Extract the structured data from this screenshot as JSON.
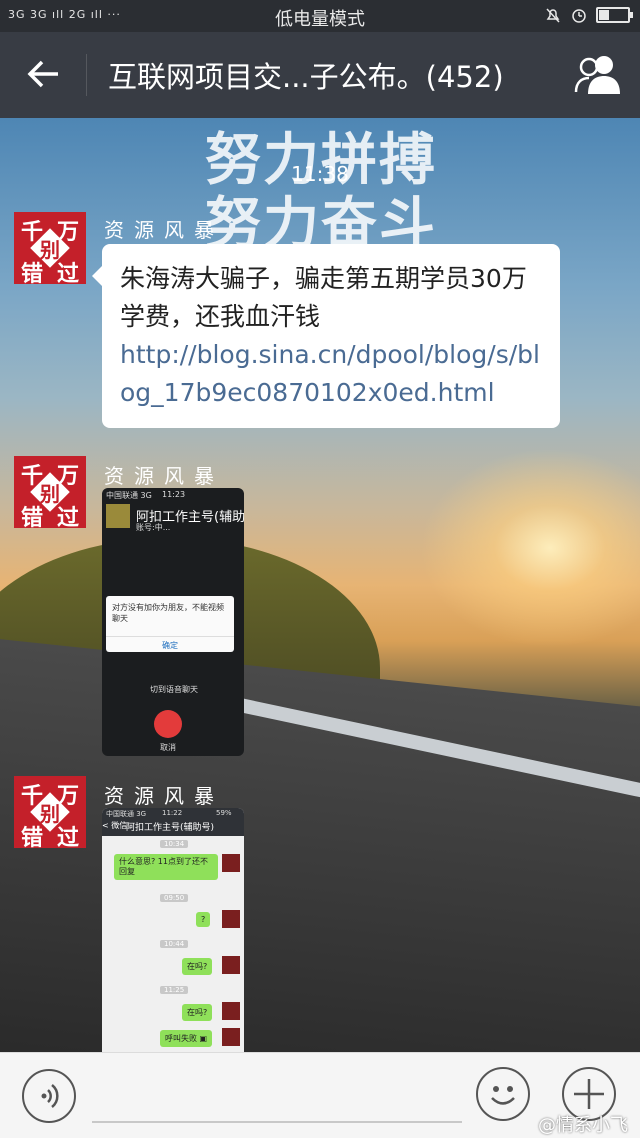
{
  "status_bar": {
    "signal_text": "3G 3G ıll 2G ıll ···",
    "mode": "低电量模式",
    "battery_level": 0.35
  },
  "header": {
    "title": "互联网项目交...子公布。(452)",
    "back_icon": "back-arrow-icon",
    "members_icon": "group-members-icon"
  },
  "chat": {
    "background_text": [
      "努力拼搏",
      "努力奋斗"
    ],
    "timestamp": "11:38",
    "messages": [
      {
        "sender": "资源风暴",
        "avatar_chars": [
          "千",
          "万",
          "别",
          "错",
          "过"
        ],
        "text": "朱海涛大骗子，骗走第五期学员30万学费，还我血汗钱",
        "link": "http://blog.sina.cn/dpool/blog/s/blog_17b9ec0870102x0ed.html"
      },
      {
        "sender": "资源风暴",
        "avatar_chars": [
          "千",
          "万",
          "别",
          "错",
          "过"
        ],
        "image": {
          "carrier": "中国联通  3G",
          "time": "11:23",
          "contact": "阿扣工作主号(辅助",
          "subtitle": "账号:中...",
          "dialog_text": "对方没有加你为朋友，不能视频聊天",
          "dialog_button": "确定",
          "switch_label": "切到语音聊天",
          "cancel_label": "取消"
        }
      },
      {
        "sender": "资源风暴",
        "avatar_chars": [
          "千",
          "万",
          "别",
          "错",
          "过"
        ],
        "image": {
          "carrier": "中国联通  3G",
          "time": "11:22",
          "battery": "59%",
          "back": "< 微信",
          "contact": "阿扣工作主号(辅助号)",
          "stamps": [
            "10:34",
            "09:50",
            "10:44",
            "11:25"
          ],
          "bubbles": [
            "什么意思? 11点到了还不回复",
            "?",
            "在吗?",
            "在吗?",
            "呼叫失败 ▣"
          ]
        }
      }
    ]
  },
  "bottom_bar": {
    "voice_icon": "voice-input-icon",
    "emoji_icon": "emoji-icon",
    "plus_icon": "plus-icon",
    "watermark": "@情系小飞"
  }
}
